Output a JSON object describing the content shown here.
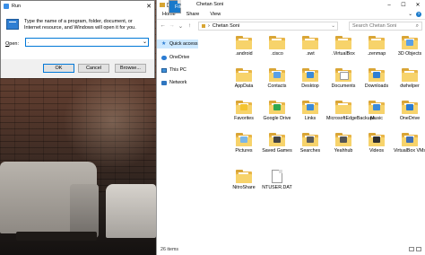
{
  "run_dialog": {
    "title": "Run",
    "description": "Type the name of a program, folder, document, or Internet resource, and Windows will open it for you.",
    "open_label_prefix": "O",
    "open_label_rest": "pen:",
    "input_value": ".",
    "buttons": {
      "ok": "OK",
      "cancel": "Cancel",
      "browse": "Browse..."
    }
  },
  "explorer": {
    "window_title": "Chetan Soni",
    "ribbon_tabs": [
      "File",
      "Home",
      "Share",
      "View"
    ],
    "address_path": "Chetan Soni",
    "search_placeholder": "Search Chetan Soni",
    "nav_pane": [
      {
        "label": "Quick access",
        "icon": "star-icon",
        "selected": true
      },
      {
        "label": "OneDrive",
        "icon": "onedrive-icon",
        "selected": false
      },
      {
        "label": "This PC",
        "icon": "computer-icon",
        "selected": false
      },
      {
        "label": "Network",
        "icon": "network-icon",
        "selected": false
      }
    ],
    "items": [
      {
        "label": ".android",
        "type": "folder"
      },
      {
        "label": ".cisco",
        "type": "folder"
      },
      {
        "label": ".swt",
        "type": "folder"
      },
      {
        "label": ".VirtualBox",
        "type": "folder"
      },
      {
        "label": ".zenmap",
        "type": "folder"
      },
      {
        "label": "3D Objects",
        "type": "folder"
      },
      {
        "label": "AppData",
        "type": "folder"
      },
      {
        "label": "Contacts",
        "type": "folder"
      },
      {
        "label": "Desktop",
        "type": "folder"
      },
      {
        "label": "Documents",
        "type": "folder"
      },
      {
        "label": "Downloads",
        "type": "folder"
      },
      {
        "label": "dwhelper",
        "type": "folder"
      },
      {
        "label": "Favorites",
        "type": "folder"
      },
      {
        "label": "Google Drive",
        "type": "folder"
      },
      {
        "label": "Links",
        "type": "folder"
      },
      {
        "label": "MicrosoftEdgeBackups",
        "type": "folder"
      },
      {
        "label": "Music",
        "type": "folder"
      },
      {
        "label": "OneDrive",
        "type": "folder"
      },
      {
        "label": "Pictures",
        "type": "folder"
      },
      {
        "label": "Saved Games",
        "type": "folder"
      },
      {
        "label": "Searches",
        "type": "folder"
      },
      {
        "label": "Yeahhub",
        "type": "folder"
      },
      {
        "label": "Videos",
        "type": "folder"
      },
      {
        "label": "VirtualBox VMs",
        "type": "folder"
      },
      {
        "label": "NitroShare",
        "type": "folder"
      },
      {
        "label": "NTUSER.DAT",
        "type": "file"
      }
    ],
    "status_text": "26 items"
  },
  "colors": {
    "accent": "#1979ca",
    "folder": "#f7d36b",
    "selection": "#cce8ff"
  }
}
